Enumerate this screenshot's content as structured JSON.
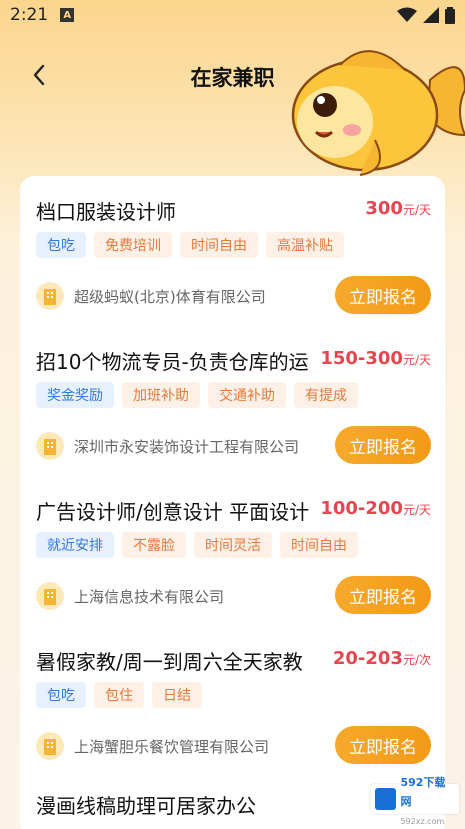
{
  "status": {
    "time": "2:21",
    "a_icon": "A"
  },
  "header": {
    "title": "在家兼职"
  },
  "jobs": [
    {
      "title": "档口服装设计师",
      "salary_amount": "300",
      "salary_unit": "元/天",
      "tags": [
        {
          "label": "包吃",
          "color": "blue"
        },
        {
          "label": "免费培训",
          "color": "orange"
        },
        {
          "label": "时间自由",
          "color": "orange"
        },
        {
          "label": "高温补贴",
          "color": "orange"
        }
      ],
      "company": "超级蚂蚁(北京)体育有限公司",
      "apply_label": "立即报名"
    },
    {
      "title": "招10个物流专员-负责仓库的运",
      "salary_amount": "150-300",
      "salary_unit": "元/天",
      "tags": [
        {
          "label": "奖金奖励",
          "color": "blue"
        },
        {
          "label": "加班补助",
          "color": "orange"
        },
        {
          "label": "交通补助",
          "color": "orange"
        },
        {
          "label": "有提成",
          "color": "orange"
        }
      ],
      "company": "深圳市永安装饰设计工程有限公司",
      "apply_label": "立即报名"
    },
    {
      "title": "广告设计师/创意设计 平面设计",
      "salary_amount": "100-200",
      "salary_unit": "元/天",
      "tags": [
        {
          "label": "就近安排",
          "color": "blue"
        },
        {
          "label": "不露脸",
          "color": "orange"
        },
        {
          "label": "时间灵活",
          "color": "orange"
        },
        {
          "label": "时间自由",
          "color": "orange"
        }
      ],
      "company": "上海信息技术有限公司",
      "apply_label": "立即报名"
    },
    {
      "title": "暑假家教/周一到周六全天家教",
      "salary_amount": "20-203",
      "salary_unit": "元/次",
      "tags": [
        {
          "label": "包吃",
          "color": "blue"
        },
        {
          "label": "包住",
          "color": "orange"
        },
        {
          "label": "日结",
          "color": "orange"
        }
      ],
      "company": "上海蟹胆乐餐饮管理有限公司",
      "apply_label": "立即报名"
    }
  ],
  "partial_job_title": "漫画线稿助理可居家办公",
  "watermark": {
    "line1": "592下载网",
    "line2": "592xz.com"
  },
  "colors": {
    "accent": "#f29a16",
    "salary": "#e8454e",
    "tag_blue": "#3578e0",
    "tag_orange": "#e67a3a"
  }
}
